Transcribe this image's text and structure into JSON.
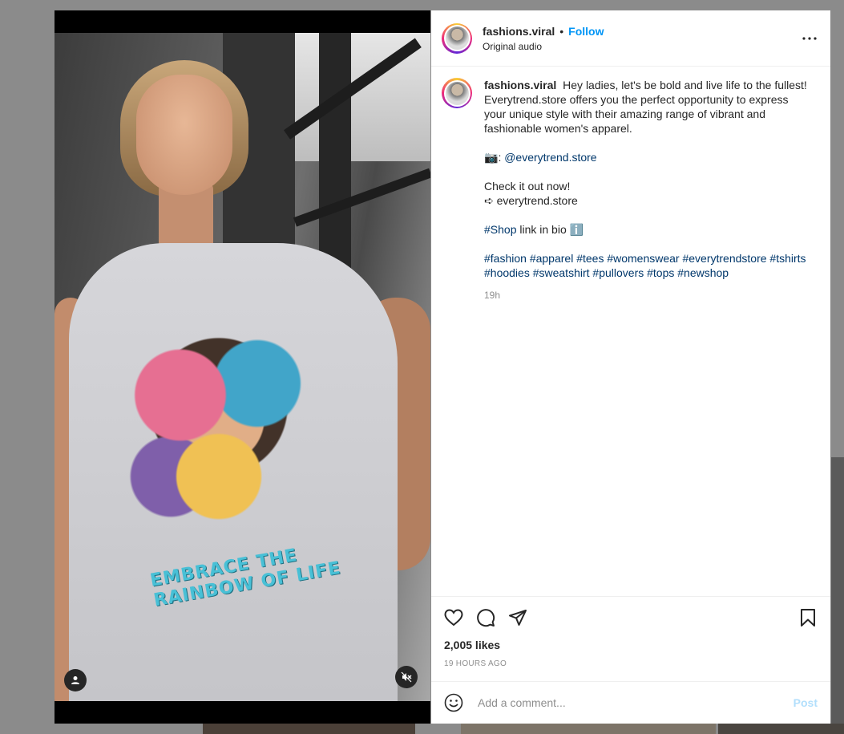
{
  "post": {
    "username": "fashions.viral",
    "follow_label": "Follow",
    "dot": "•",
    "audio": "Original audio",
    "more_label": "•••",
    "caption": {
      "username": "fashions.viral",
      "line1": "Hey ladies, let's be bold and live life to the fullest! Everytrend.store offers you the perfect opportunity to express your unique style with their amazing range of vibrant and fashionable women's apparel.",
      "photo_emoji": "📷",
      "credit_prefix": ": ",
      "credit_handle": "@everytrend.store",
      "check_out": "Check it out now!",
      "arrow": "➪",
      "site": "everytrend.store",
      "shop_tag": "#Shop",
      "shop_text": " link in bio ",
      "info_emoji": "ℹ️",
      "hashtags_line1": "#fashion #apparel #tees #womenswear #everytrendstore #tshirts",
      "hashtags_line2": "#hoodies #sweatshirt #pullovers #tops #newshop"
    },
    "timestamp": "19h",
    "likes": "2,005 likes",
    "time_ago": "19 HOURS AGO",
    "comment_placeholder": "Add a comment...",
    "post_label": "Post"
  },
  "media": {
    "shirt_print_text": "EMBRACE THE RAINBOW OF LIFE"
  },
  "colors": {
    "follow": "#0095f6",
    "link": "#00376b",
    "post_disabled": "#b2dffc",
    "muted_text": "#8e8e8e"
  }
}
